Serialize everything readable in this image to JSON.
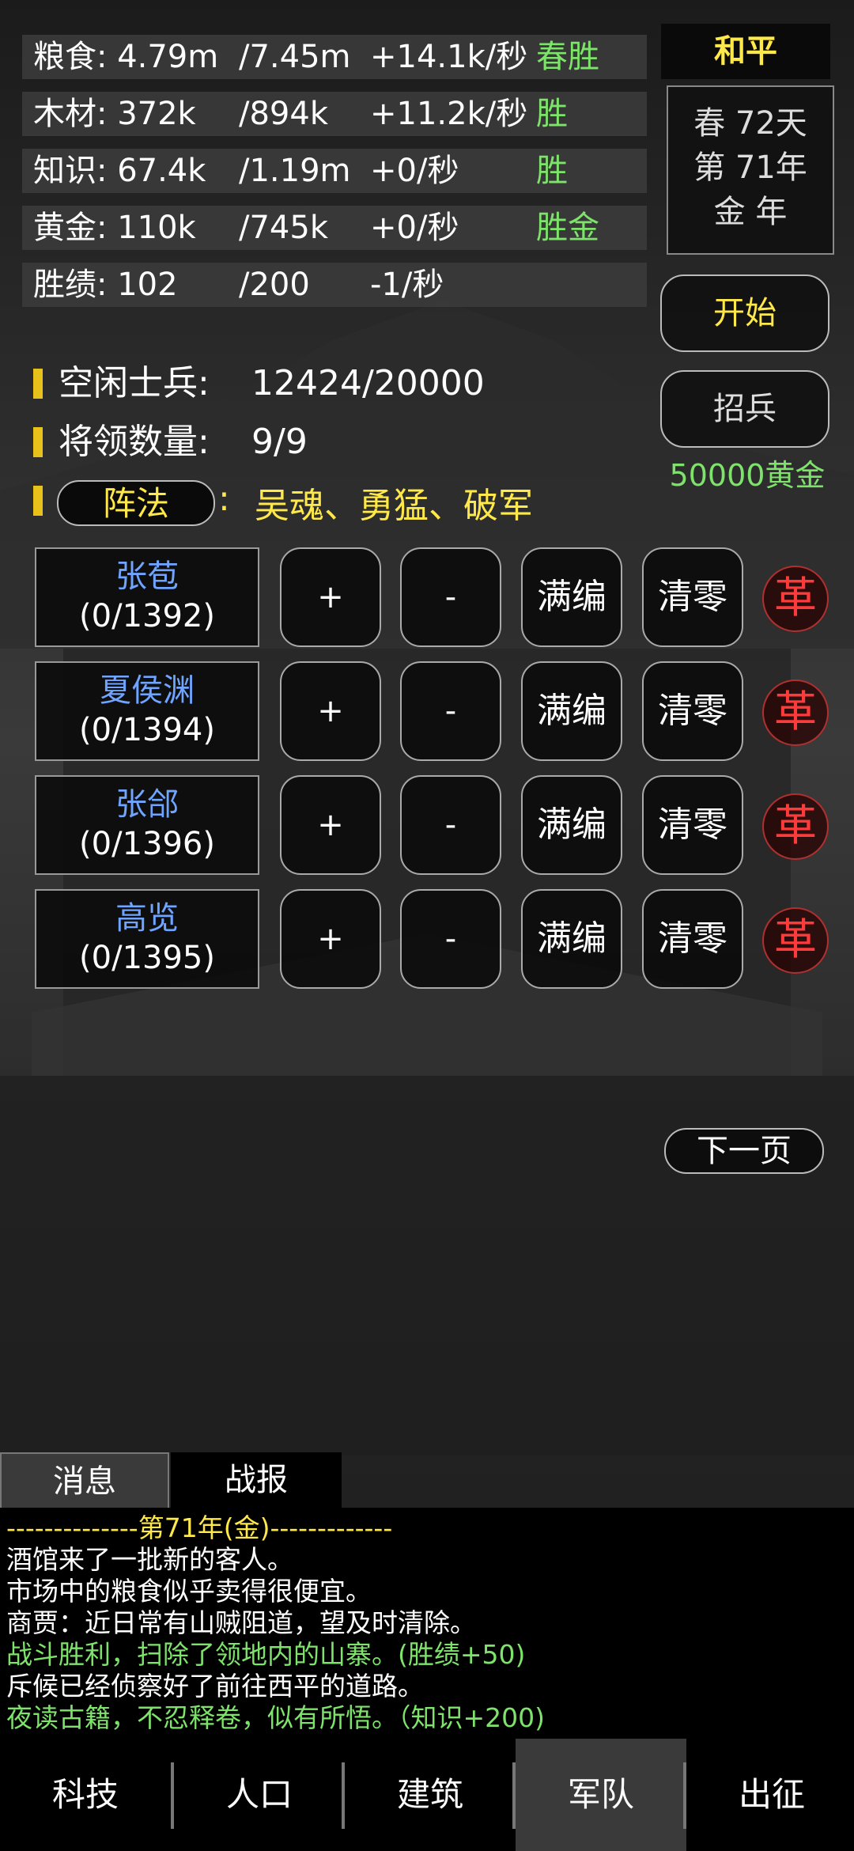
{
  "resources": [
    {
      "name": "粮食: 4.79m",
      "cap": "/7.45m",
      "rate": "+14.1k/秒",
      "tag": "春胜"
    },
    {
      "name": "木材: 372k",
      "cap": "/894k",
      "rate": "+11.2k/秒",
      "tag": "胜"
    },
    {
      "name": "知识: 67.4k",
      "cap": "/1.19m",
      "rate": "+0/秒",
      "tag": "胜"
    },
    {
      "name": "黄金: 110k",
      "cap": "/745k",
      "rate": "+0/秒",
      "tag": "胜金"
    },
    {
      "name": "胜绩: 102",
      "cap": "/200",
      "rate": "-1/秒",
      "tag": ""
    }
  ],
  "status_peace": "和平",
  "date": {
    "line1": "春 72天",
    "line2": "第 71年",
    "line3": "金 年"
  },
  "start_label": "开始",
  "recruit_label": "招兵",
  "recruit_cost": "50000黄金",
  "idle_soldiers": {
    "label": "空闲士兵:",
    "value": "12424/20000"
  },
  "general_count": {
    "label": "将领数量:",
    "value": "9/9"
  },
  "formation": {
    "label": "阵法",
    "colon": ":",
    "value": "吴魂、勇猛、破军"
  },
  "generals": [
    {
      "name": "张苞",
      "count": "(0/1392)"
    },
    {
      "name": "夏侯渊",
      "count": "(0/1394)"
    },
    {
      "name": "张郃",
      "count": "(0/1396)"
    },
    {
      "name": "高览",
      "count": "(0/1395)"
    }
  ],
  "btn_labels": {
    "plus": "+",
    "minus": "-",
    "full": "满编",
    "clear": "清零",
    "reform": "革"
  },
  "next_page": "下一页",
  "tabs": {
    "messages": "消息",
    "reports": "战报"
  },
  "log": [
    {
      "text": "--------------第71年(金)-------------",
      "color": "#ffe84a"
    },
    {
      "text": "酒馆来了一批新的客人。",
      "color": "#ffffff"
    },
    {
      "text": "市场中的粮食似乎卖得很便宜。",
      "color": "#ffffff"
    },
    {
      "text": "商贾：近日常有山贼阻道，望及时清除。",
      "color": "#ffffff"
    },
    {
      "text": "战斗胜利，扫除了领地内的山寨。(胜绩+50)",
      "color": "#7ee36b"
    },
    {
      "text": "斥候已经侦察好了前往西平的道路。",
      "color": "#ffffff"
    },
    {
      "text": "夜读古籍，不忍释卷，似有所悟。（知识+200)",
      "color": "#7ee36b"
    }
  ],
  "nav": [
    "科技",
    "人口",
    "建筑",
    "军队",
    "出征"
  ],
  "nav_active": 3
}
